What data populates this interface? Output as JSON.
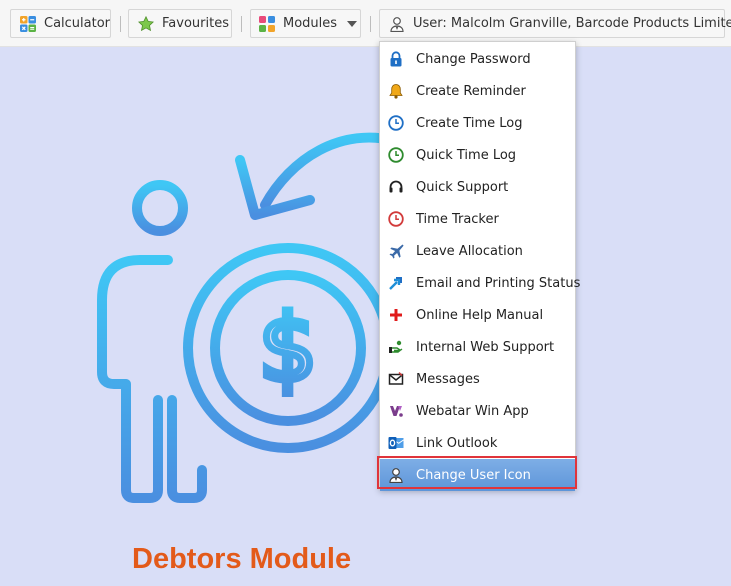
{
  "toolbar": {
    "calculator_label": "Calculator",
    "favourites_label": "Favourites",
    "modules_label": "Modules",
    "user_label": "User: Malcolm Granville, Barcode Products Limited"
  },
  "menu": {
    "items": [
      {
        "label": "Change Password",
        "icon": "lock-icon"
      },
      {
        "label": "Create Reminder",
        "icon": "bell-icon"
      },
      {
        "label": "Create Time Log",
        "icon": "clock-icon"
      },
      {
        "label": "Quick Time Log",
        "icon": "clock-icon"
      },
      {
        "label": "Quick Support",
        "icon": "headset-icon"
      },
      {
        "label": "Time Tracker",
        "icon": "clock-icon"
      },
      {
        "label": "Leave Allocation",
        "icon": "plane-icon"
      },
      {
        "label": "Email and Printing Status",
        "icon": "arrows-icon"
      },
      {
        "label": "Online Help Manual",
        "icon": "plus-icon"
      },
      {
        "label": "Internal Web Support",
        "icon": "support-icon"
      },
      {
        "label": "Messages",
        "icon": "envelope-icon"
      },
      {
        "label": "Webatar Win App",
        "icon": "app-icon"
      },
      {
        "label": "Link Outlook",
        "icon": "outlook-icon"
      },
      {
        "label": "Change User Icon",
        "icon": "user-icon"
      }
    ],
    "active_index": 13
  },
  "main": {
    "module_title": "Debtors Module"
  },
  "colors": {
    "background": "#d9def7",
    "accent_orange": "#e35a1a",
    "highlight_red": "#e0343b",
    "selected_blue": "#6aa0df",
    "illustration_blue": "#3ea8f0"
  }
}
